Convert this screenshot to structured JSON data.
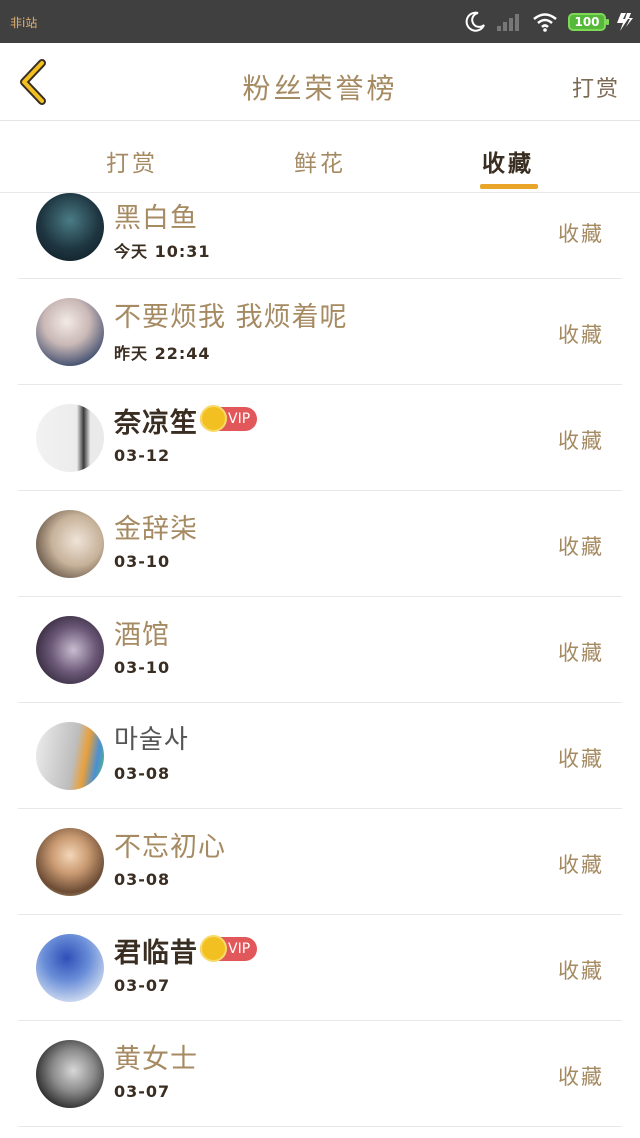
{
  "status_bar": {
    "left_text": "非i站",
    "battery": "100"
  },
  "header": {
    "title": "粉丝荣誉榜",
    "action": "打赏"
  },
  "tabs": [
    {
      "label": "打赏"
    },
    {
      "label": "鲜花"
    },
    {
      "label": "收藏",
      "active": true
    }
  ],
  "fans": [
    {
      "name": "黑白鱼",
      "time": "今天 10:31",
      "action": "收藏",
      "vip": false
    },
    {
      "name": "不要烦我 我烦着呢",
      "time": "昨天 22:44",
      "action": "收藏",
      "vip": false
    },
    {
      "name": "奈凉笙",
      "time": "03-12",
      "action": "收藏",
      "vip": true,
      "vip_label": "VIP"
    },
    {
      "name": "金辞柒",
      "time": "03-10",
      "action": "收藏",
      "vip": false
    },
    {
      "name": "酒馆",
      "time": "03-10",
      "action": "收藏",
      "vip": false
    },
    {
      "name": "마술사",
      "time": "03-08",
      "action": "收藏",
      "vip": false
    },
    {
      "name": "不忘初心",
      "time": "03-08",
      "action": "收藏",
      "vip": false
    },
    {
      "name": "君临昔",
      "time": "03-07",
      "action": "收藏",
      "vip": true,
      "vip_label": "VIP"
    },
    {
      "name": "黄女士",
      "time": "03-07",
      "action": "收藏",
      "vip": false
    }
  ],
  "colors": {
    "accent": "#e9a42a",
    "text_brown": "#a58a62",
    "vip": "#e2575a"
  }
}
